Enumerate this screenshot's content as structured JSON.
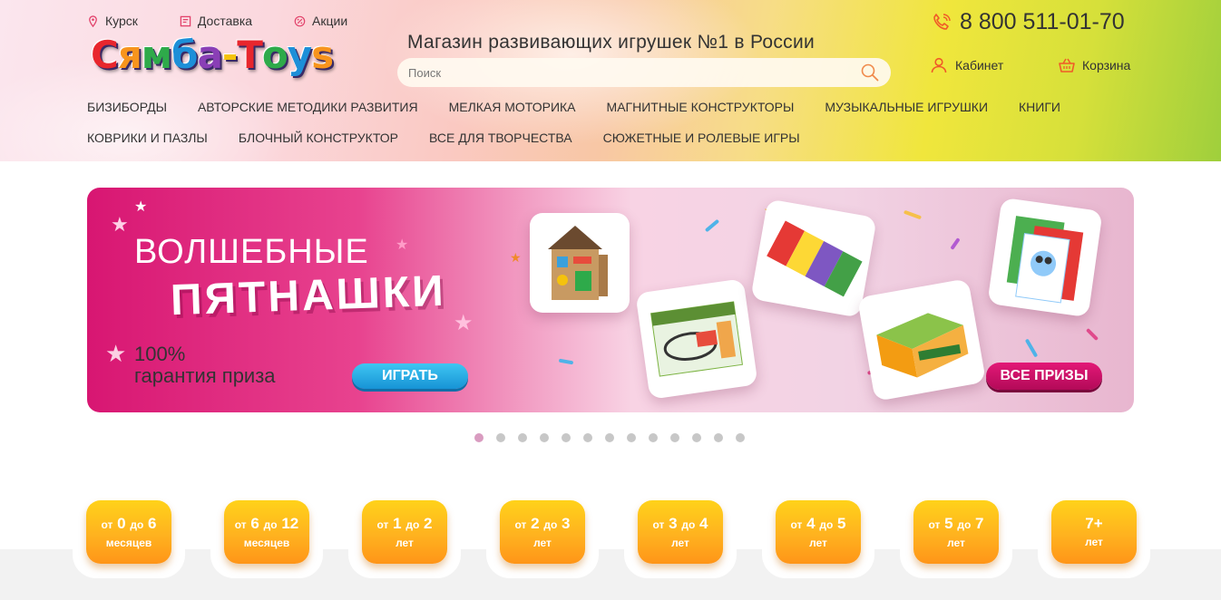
{
  "header": {
    "top_links": [
      {
        "label": "Курск",
        "icon": "location-pin-icon"
      },
      {
        "label": "Доставка",
        "icon": "delivery-icon"
      },
      {
        "label": "Акции",
        "icon": "discount-icon"
      }
    ],
    "logo_text": "Сямба-Toys",
    "slogan": "Магазин развивающих игрушек №1 в России",
    "search_placeholder": "Поиск",
    "phone": "8 800 511-01-70",
    "account_label": "Кабинет",
    "cart_label": "Корзина",
    "accent_color": "#f05a28"
  },
  "categories": {
    "row1": [
      "Бизиборды",
      "Авторские методики развития",
      "Мелкая моторика",
      "Магнитные конструкторы",
      "Музыкальные игрушки",
      "Книги"
    ],
    "row2": [
      "Коврики и пазлы",
      "Блочный конструктор",
      "Все для творчества",
      "Сюжетные и ролевые игры"
    ]
  },
  "banner": {
    "title_line1": "ВОЛШЕБНЫЕ",
    "title_line2": "ПЯТНАШКИ",
    "guarantee_line1": "100%",
    "guarantee_line2": "гарантия приза",
    "play_button": "ИГРАТЬ",
    "prizes_button": "ВСЕ ПРИЗЫ",
    "colors": {
      "primary": "#d81672",
      "play": "#1793d6"
    }
  },
  "slider": {
    "total_dots": 13,
    "active_index": 0
  },
  "age_filters": [
    {
      "from_word": "от",
      "from": "0",
      "to_word": "до",
      "to": "6",
      "unit": "месяцев"
    },
    {
      "from_word": "от",
      "from": "6",
      "to_word": "до",
      "to": "12",
      "unit": "месяцев"
    },
    {
      "from_word": "от",
      "from": "1",
      "to_word": "до",
      "to": "2",
      "unit": "лет"
    },
    {
      "from_word": "от",
      "from": "2",
      "to_word": "до",
      "to": "3",
      "unit": "лет"
    },
    {
      "from_word": "от",
      "from": "3",
      "to_word": "до",
      "to": "4",
      "unit": "лет"
    },
    {
      "from_word": "от",
      "from": "4",
      "to_word": "до",
      "to": "5",
      "unit": "лет"
    },
    {
      "from_word": "от",
      "from": "5",
      "to_word": "до",
      "to": "7",
      "unit": "лет"
    },
    {
      "from_word": "",
      "from": "7+",
      "to_word": "",
      "to": "",
      "unit": "лет"
    }
  ]
}
